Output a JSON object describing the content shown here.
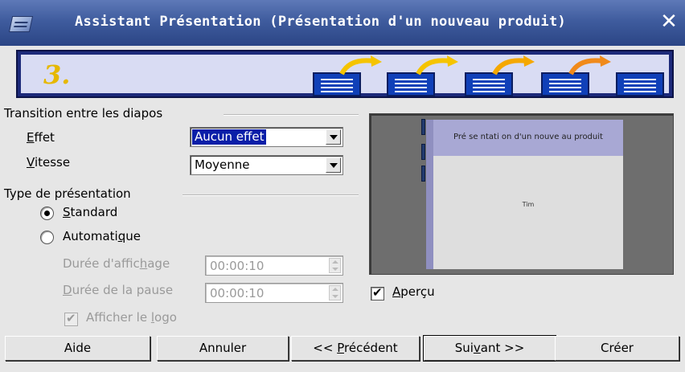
{
  "window": {
    "title": "Assistant Présentation (Présentation d'un nouveau produit)",
    "close_glyph": "✕"
  },
  "banner": {
    "step": "3.",
    "icons": [
      "slide-icon",
      "slide-icon",
      "slide-icon",
      "slide-icon",
      "slide-icon"
    ],
    "arrow_color": "#f5c400"
  },
  "transition": {
    "group_label": "Transition entre les diapos",
    "effect_label_prefix": "",
    "effect_mnemonic": "E",
    "effect_label_rest": "ffet",
    "effect_value": "Aucun effet",
    "speed_mnemonic": "V",
    "speed_label_rest": "itesse",
    "speed_value": "Moyenne"
  },
  "presentation_type": {
    "group_label": "Type de présentation",
    "standard_mnemonic": "S",
    "standard_rest": "tandard",
    "standard_checked": true,
    "auto_prefix": "Automati",
    "auto_mnemonic": "q",
    "auto_rest": "ue",
    "auto_checked": false,
    "display_duration_prefix": "Durée d'affic",
    "display_duration_mnemonic": "h",
    "display_duration_rest": "age",
    "display_duration_value": "00:00:10",
    "pause_duration_mnemonic": "D",
    "pause_duration_rest": "urée de la pause",
    "pause_duration_value": "00:00:10",
    "logo_prefix": "Afficher le ",
    "logo_mnemonic": "l",
    "logo_rest": "ogo",
    "logo_checked": true
  },
  "preview": {
    "slide_title": "Pré se ntati on d'un nouve au produit",
    "slide_subtitle": "Tim",
    "checkbox_mnemonic": "A",
    "checkbox_rest": "perçu",
    "checkbox_checked": true,
    "colors": {
      "slide_header": "#a8a8d4",
      "slide_body": "#dedede",
      "frame": "#6e6e6e"
    }
  },
  "buttons": {
    "help": "Aide",
    "cancel": "Annuler",
    "prev_prefix": "<< ",
    "prev_mnemonic": "P",
    "prev_rest": "récédent",
    "next_prefix": "Sui",
    "next_mnemonic": "v",
    "next_rest": "ant >>",
    "create": "Créer"
  }
}
